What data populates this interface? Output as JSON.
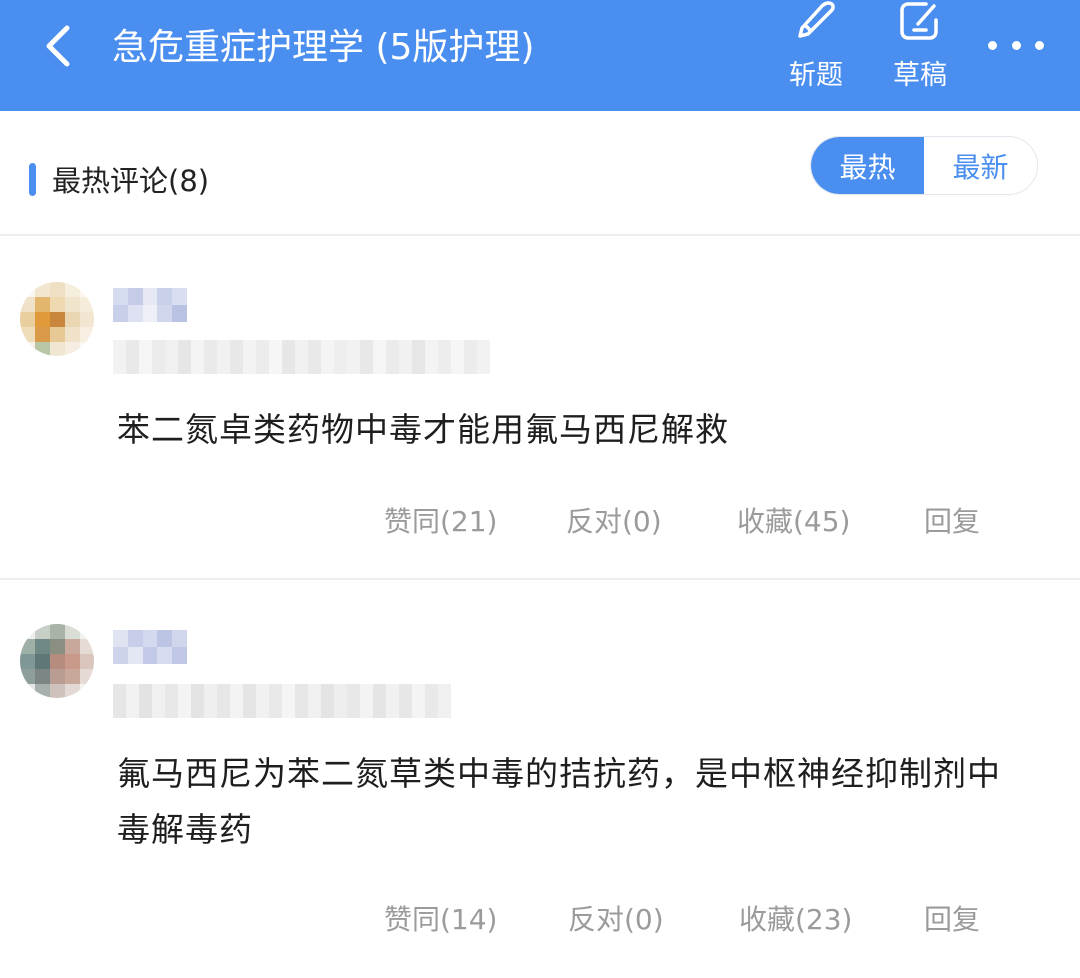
{
  "header": {
    "title": "急危重症护理学 (5版护理)",
    "buttons": [
      {
        "label": "斩题",
        "icon": "knife-icon"
      },
      {
        "label": "草稿",
        "icon": "edit-draft-icon"
      }
    ],
    "accent": "#4a8ef0"
  },
  "section": {
    "title": "最热评论(8)",
    "sort_options": [
      "最热",
      "最新"
    ],
    "active_sort": "最热"
  },
  "comments": [
    {
      "text": "苯二氮卓类药物中毒才能用氟马西尼解救",
      "actions": [
        "赞同(21)",
        "反对(0)",
        "收藏(45)",
        "回复"
      ]
    },
    {
      "text": "氟马西尼为苯二氮草类中毒的拮抗药，是中枢神经抑制剂中毒解毒药",
      "actions": [
        "赞同(14)",
        "反对(0)",
        "收藏(23)",
        "回复"
      ]
    }
  ]
}
